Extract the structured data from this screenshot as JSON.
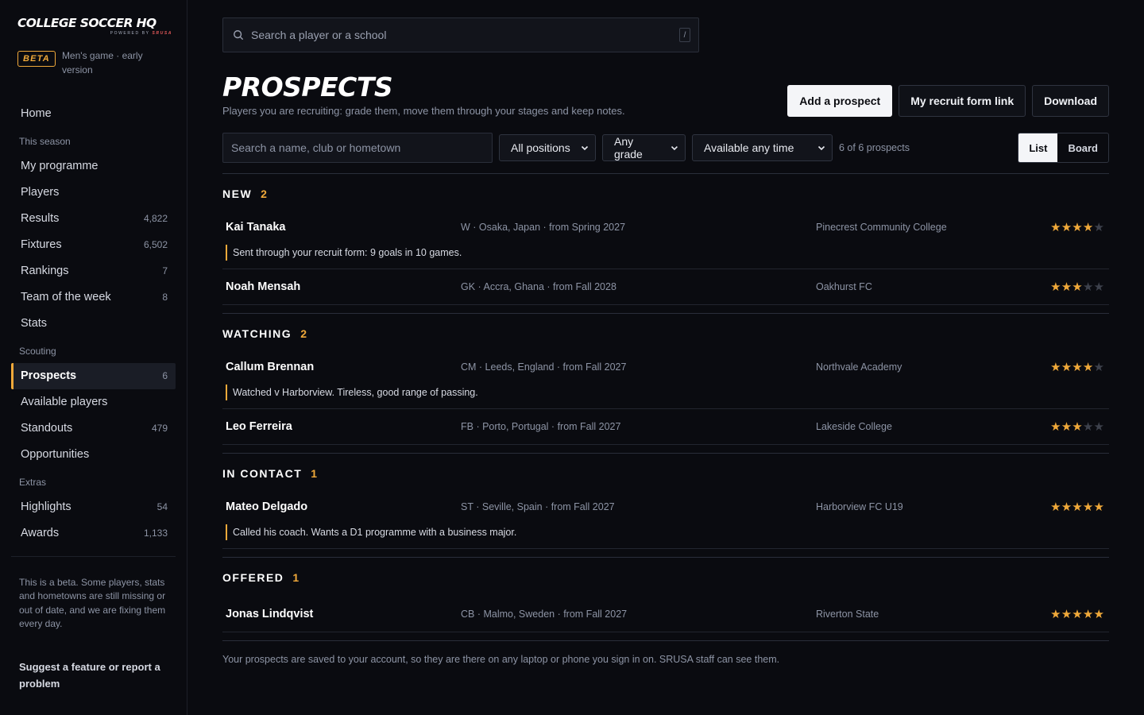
{
  "brand": {
    "logo_text": "COLLEGE SOCCER HQ",
    "logo_sub_prefix": "POWERED BY",
    "logo_sub_brand": "SRUSA",
    "beta_badge": "BETA",
    "beta_text": "Men's game · early version"
  },
  "nav": {
    "home": "Home",
    "sections": [
      {
        "title": "This season",
        "items": [
          {
            "label": "My programme",
            "count": ""
          },
          {
            "label": "Players",
            "count": ""
          },
          {
            "label": "Results",
            "count": "4,822"
          },
          {
            "label": "Fixtures",
            "count": "6,502"
          },
          {
            "label": "Rankings",
            "count": "7"
          },
          {
            "label": "Team of the week",
            "count": "8"
          },
          {
            "label": "Stats",
            "count": ""
          }
        ]
      },
      {
        "title": "Scouting",
        "items": [
          {
            "label": "Prospects",
            "count": "6"
          },
          {
            "label": "Available players",
            "count": ""
          },
          {
            "label": "Standouts",
            "count": "479"
          },
          {
            "label": "Opportunities",
            "count": ""
          }
        ]
      },
      {
        "title": "Extras",
        "items": [
          {
            "label": "Highlights",
            "count": "54"
          },
          {
            "label": "Awards",
            "count": "1,133"
          }
        ]
      }
    ],
    "active": "Prospects",
    "note": "This is a beta. Some players, stats and hometowns are still missing or out of date, and we are fixing them every day.",
    "feedback_link": "Suggest a feature or report a problem"
  },
  "top_search": {
    "placeholder": "Search a player or a school",
    "shortcut": "/"
  },
  "page": {
    "title": "PROSPECTS",
    "subtitle": "Players you are recruiting: grade them, move them through your stages and keep notes.",
    "actions": {
      "add": "Add a prospect",
      "form_link": "My recruit form link",
      "download": "Download"
    }
  },
  "filters": {
    "search_placeholder": "Search a name, club or hometown",
    "position": "All positions",
    "grade": "Any grade",
    "availability": "Available any time",
    "count_text": "6 of 6 prospects",
    "view_list": "List",
    "view_board": "Board",
    "view_selected": "List"
  },
  "groups": [
    {
      "title": "NEW",
      "count": "2",
      "prospects": [
        {
          "name": "Kai Tanaka",
          "meta": "W · Osaka, Japan · from Spring 2027",
          "club": "Pinecrest Community College",
          "rating": 4,
          "note": "Sent through your recruit form: 9 goals in 10 games."
        },
        {
          "name": "Noah Mensah",
          "meta": "GK · Accra, Ghana · from Fall 2028",
          "club": "Oakhurst FC",
          "rating": 3,
          "note": ""
        }
      ]
    },
    {
      "title": "WATCHING",
      "count": "2",
      "prospects": [
        {
          "name": "Callum Brennan",
          "meta": "CM · Leeds, England · from Fall 2027",
          "club": "Northvale Academy",
          "rating": 4,
          "note": "Watched v Harborview. Tireless, good range of passing."
        },
        {
          "name": "Leo Ferreira",
          "meta": "FB · Porto, Portugal · from Fall 2027",
          "club": "Lakeside College",
          "rating": 3,
          "note": ""
        }
      ]
    },
    {
      "title": "IN CONTACT",
      "count": "1",
      "prospects": [
        {
          "name": "Mateo Delgado",
          "meta": "ST · Seville, Spain · from Fall 2027",
          "club": "Harborview FC U19",
          "rating": 5,
          "note": "Called his coach. Wants a D1 programme with a business major."
        }
      ]
    },
    {
      "title": "OFFERED",
      "count": "1",
      "prospects": [
        {
          "name": "Jonas Lindqvist",
          "meta": "CB · Malmo, Sweden · from Fall 2027",
          "club": "Riverton State",
          "rating": 5,
          "note": ""
        }
      ]
    }
  ],
  "footer_note": "Your prospects are saved to your account, so they are there on any laptop or phone you sign in on. SRUSA staff can see them.",
  "colors": {
    "accent": "#f0a93a",
    "background": "#0a0b10"
  }
}
